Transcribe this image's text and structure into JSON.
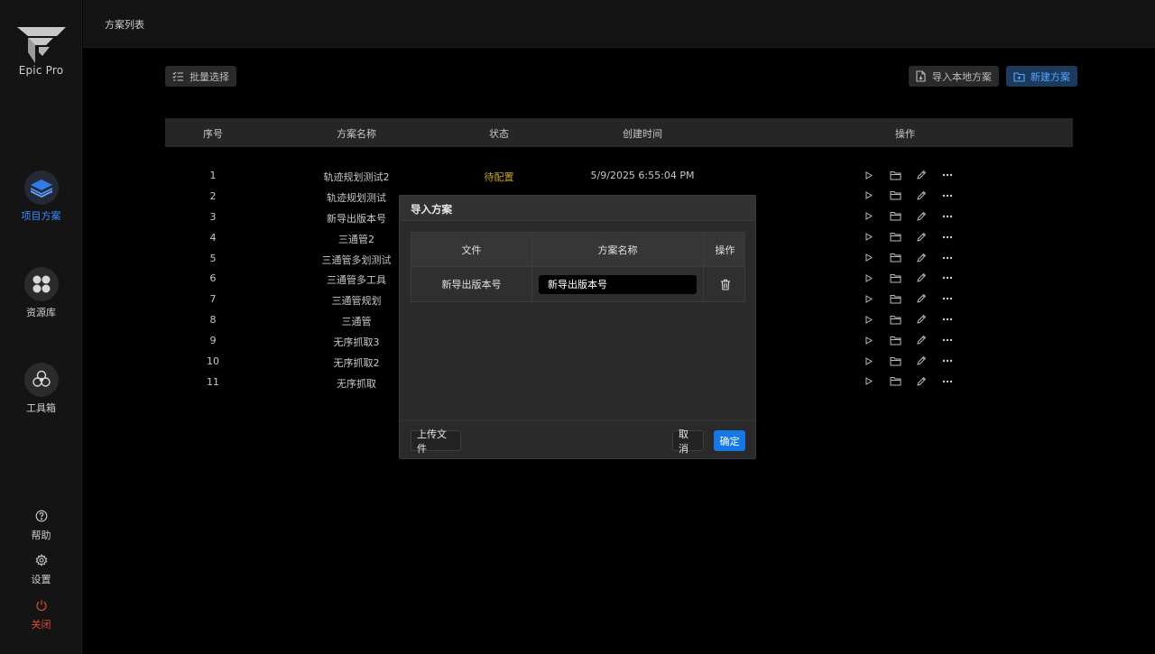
{
  "app": {
    "name": "Epic Pro"
  },
  "sidebar": {
    "items": [
      {
        "label": "项目方案",
        "icon": "layers-icon",
        "active": true
      },
      {
        "label": "资源库",
        "icon": "grid-dots-icon",
        "active": false
      },
      {
        "label": "工具箱",
        "icon": "flower-icon",
        "active": false
      }
    ],
    "bottom": [
      {
        "label": "帮助",
        "icon": "help-icon"
      },
      {
        "label": "设置",
        "icon": "gear-icon"
      },
      {
        "label": "关闭",
        "icon": "power-icon"
      }
    ]
  },
  "header": {
    "title": "方案列表"
  },
  "toolbar": {
    "batch_select": "批量选择",
    "import_local": "导入本地方案",
    "new_plan": "新建方案"
  },
  "table": {
    "columns": [
      "序号",
      "方案名称",
      "状态",
      "创建时间",
      "操作"
    ],
    "rows": [
      {
        "index": "1",
        "name": "轨迹规划测试2",
        "status": "待配置",
        "created": "5/9/2025 6:55:04 PM"
      },
      {
        "index": "2",
        "name": "轨迹规划测试",
        "status": "",
        "created": ""
      },
      {
        "index": "3",
        "name": "新导出版本号",
        "status": "",
        "created": ""
      },
      {
        "index": "4",
        "name": "三通管2",
        "status": "",
        "created": ""
      },
      {
        "index": "5",
        "name": "三通管多划测试",
        "status": "",
        "created": ""
      },
      {
        "index": "6",
        "name": "三通管多工具",
        "status": "",
        "created": ""
      },
      {
        "index": "7",
        "name": "三通管规划",
        "status": "",
        "created": ""
      },
      {
        "index": "8",
        "name": "三通管",
        "status": "",
        "created": ""
      },
      {
        "index": "9",
        "name": "无序抓取3",
        "status": "",
        "created": ""
      },
      {
        "index": "10",
        "name": "无序抓取2",
        "status": "",
        "created": ""
      },
      {
        "index": "11",
        "name": "无序抓取",
        "status": "",
        "created": ""
      }
    ],
    "row_actions": [
      "play-icon",
      "folder-icon",
      "pencil-icon",
      "more-icon"
    ]
  },
  "modal": {
    "title": "导入方案",
    "columns": [
      "文件",
      "方案名称",
      "操作"
    ],
    "rows": [
      {
        "file": "新导出版本号",
        "name_value": "新导出版本号"
      }
    ],
    "upload_label": "上传文件",
    "cancel_label": "取消",
    "confirm_label": "确定"
  },
  "colors": {
    "accent": "#3b8cff",
    "primary_button": "#1677e6",
    "status_pending": "#c9a227",
    "danger": "#e0483c"
  }
}
